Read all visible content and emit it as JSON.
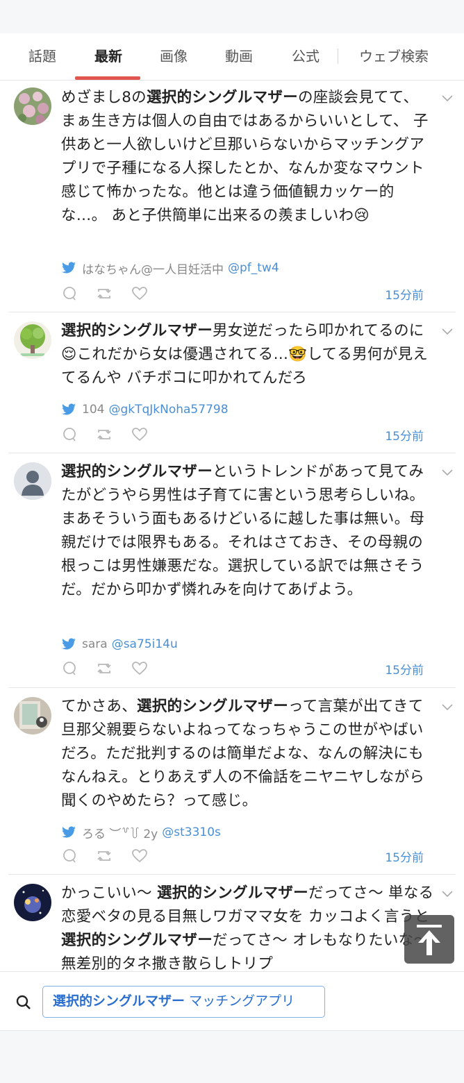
{
  "tabs": [
    {
      "label": "話題"
    },
    {
      "label": "最新"
    },
    {
      "label": "画像"
    },
    {
      "label": "動画"
    },
    {
      "label": "公式"
    },
    {
      "label": "ウェブ検索"
    }
  ],
  "tweets": [
    {
      "segments": [
        {
          "text": "めざまし8の",
          "bold": false
        },
        {
          "text": "選択的シングルマザー",
          "bold": true
        },
        {
          "text": "の座談会見てて、 まぁ生き方は個人の自由ではあるからいいとして、 子供あと一人欲しいけど旦那いらないからマッチングアプリで子種になる人探したとか、なんか変なマウント感じて怖かったな。他とは違う価値観カッケー的な…。 あと子供簡単に出来るの羨ましいわ😢",
          "bold": false
        }
      ],
      "user": "はなちゃん@一人目妊活中",
      "handle": "@pf_tw4",
      "time": "15分前"
    },
    {
      "segments": [
        {
          "text": "選択的シングルマザー",
          "bold": true
        },
        {
          "text": "男女逆だったら叩かれてるのに😌これだから女は優遇されてる…🤓してる男何が見えてるんや バチボコに叩かれてんだろ",
          "bold": false
        }
      ],
      "user": "104",
      "handle": "@gkTqJkNoha57798",
      "time": "15分前"
    },
    {
      "segments": [
        {
          "text": "選択的シングルマザー",
          "bold": true
        },
        {
          "text": "というトレンドがあって見てみたがどうやら男性は子育てに害という思考らしいね。まあそういう面もあるけどいるに越した事は無い。母親だけでは限界もある。それはさておき、その母親の根っこは男性嫌悪だな。選択している訳では無さそうだ。だから叩かず憐れみを向けてあげよう。",
          "bold": false
        }
      ],
      "user": "sara",
      "handle": "@sa75i14u",
      "time": "15分前"
    },
    {
      "segments": [
        {
          "text": "てかさあ、",
          "bold": false
        },
        {
          "text": "選択的シングルマザー",
          "bold": true
        },
        {
          "text": "って言葉が出てきて旦那父親要らないよねってなっちゃうこの世がやばいだろ。ただ批判するのは簡単だよな、なんの解決にもなんねえ。とりあえず人の不倫話をニヤニヤしながら聞くのやめたら？って感じ。",
          "bold": false
        }
      ],
      "user": "ろる ︶꒷꒦ 2y",
      "handle": "@st3310s",
      "time": "15分前"
    },
    {
      "segments": [
        {
          "text": "かっこいい〜 ",
          "bold": false
        },
        {
          "text": "選択的シングルマザー",
          "bold": true
        },
        {
          "text": "だってさ〜 単なる恋愛ベタの見る目無しワガママ女を カッコよく言うと ",
          "bold": false
        },
        {
          "text": "選択的シングルマザー",
          "bold": true
        },
        {
          "text": "だってさ〜 オレもなりたいな〜 無差別的タネ撒き散らしトリプ",
          "bold": false
        }
      ],
      "user": "",
      "handle": "",
      "time": ""
    }
  ],
  "search": {
    "keyword": "選択的シングルマザー",
    "extra": "マッチングアプリ"
  },
  "colors": {
    "accent_underline": "#e0554f",
    "link": "#4a8fd4",
    "twitter": "#4a9be6"
  }
}
